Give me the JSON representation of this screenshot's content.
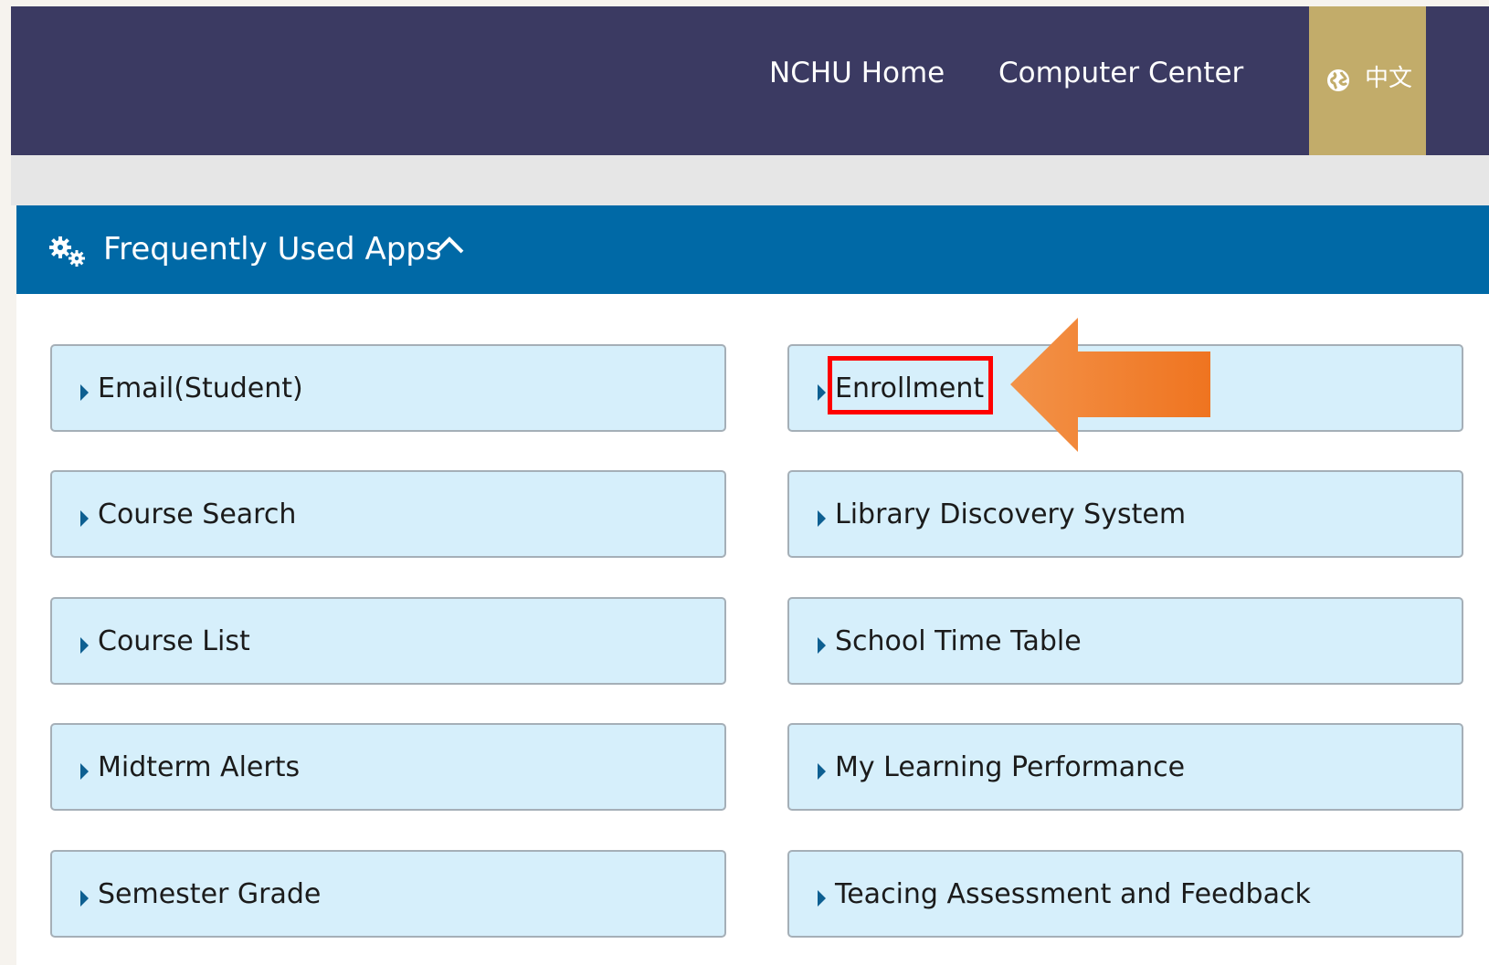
{
  "header": {
    "nav": [
      "NCHU Home",
      "Computer Center"
    ],
    "language": "中文",
    "language_icon": "globe-icon",
    "bg_color": "#3b3a62",
    "lang_bg_color": "#c2ac6a"
  },
  "panel": {
    "title": "Frequently Used Apps",
    "icon": "gears-icon",
    "toggle_icon": "chevron-up-icon",
    "header_color": "#0069a6"
  },
  "apps": {
    "left": [
      "Email(Student)",
      "Course Search",
      "Course List",
      "Midterm Alerts",
      "Semester Grade"
    ],
    "right": [
      "Enrollment",
      "Library Discovery System",
      "School Time Table",
      "My Learning Performance",
      "Teacing Assessment and Feedback"
    ],
    "button_bg": "#d6effb"
  },
  "annotation": {
    "highlight": "Enrollment",
    "highlight_color": "#ff0000",
    "arrow_color": "#f07a2a"
  }
}
